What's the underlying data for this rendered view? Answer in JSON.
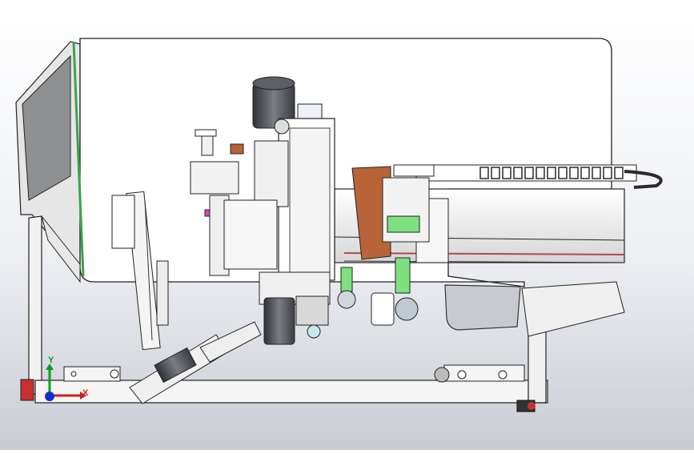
{
  "viewport": {
    "background_top": "#ffffff",
    "background_bottom": "#c9ccd3"
  },
  "model": {
    "frame_color": "#f2f2f2",
    "table_color": "#ffffff",
    "table_edge_color": "#3aa44a",
    "motor_color": "#505458",
    "bracket_color": "#b86438",
    "roller_color": "#7fe07f",
    "highlight_color": "#e040c0",
    "drag_chain_color": "#2a2a2a"
  },
  "triad": {
    "x_label": "X",
    "y_label": "Y",
    "x_color": "#d02020",
    "y_color": "#109a20",
    "z_color": "#1030d0"
  }
}
